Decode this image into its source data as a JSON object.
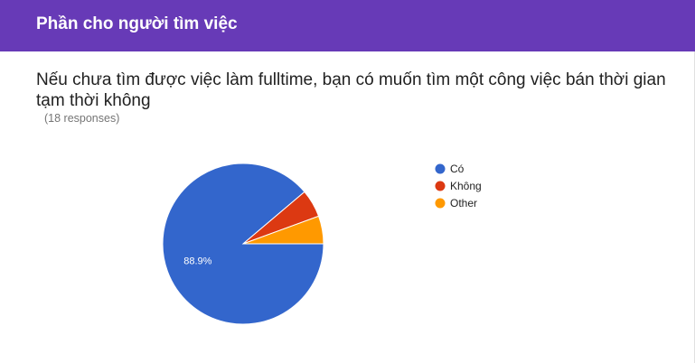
{
  "header": {
    "title": "Phần cho người tìm việc"
  },
  "question": {
    "title": "Nếu chưa tìm được việc làm fulltime, bạn có muốn tìm một công việc bán thời gian tạm thời không",
    "responses": "(18 responses)"
  },
  "colors": {
    "header": "#673ab7",
    "co": "#3366cc",
    "khong": "#dc3912",
    "other": "#ff9900"
  },
  "chart_data": {
    "type": "pie",
    "legend_position": "right",
    "slices": [
      {
        "label": "Có",
        "count": 16,
        "value": 88.9,
        "color": "#3366cc",
        "data_label": "88.9%"
      },
      {
        "label": "Không",
        "count": 1,
        "value": 5.6,
        "color": "#dc3912",
        "data_label": ""
      },
      {
        "label": "Other",
        "count": 1,
        "value": 5.6,
        "color": "#ff9900",
        "data_label": ""
      }
    ]
  }
}
